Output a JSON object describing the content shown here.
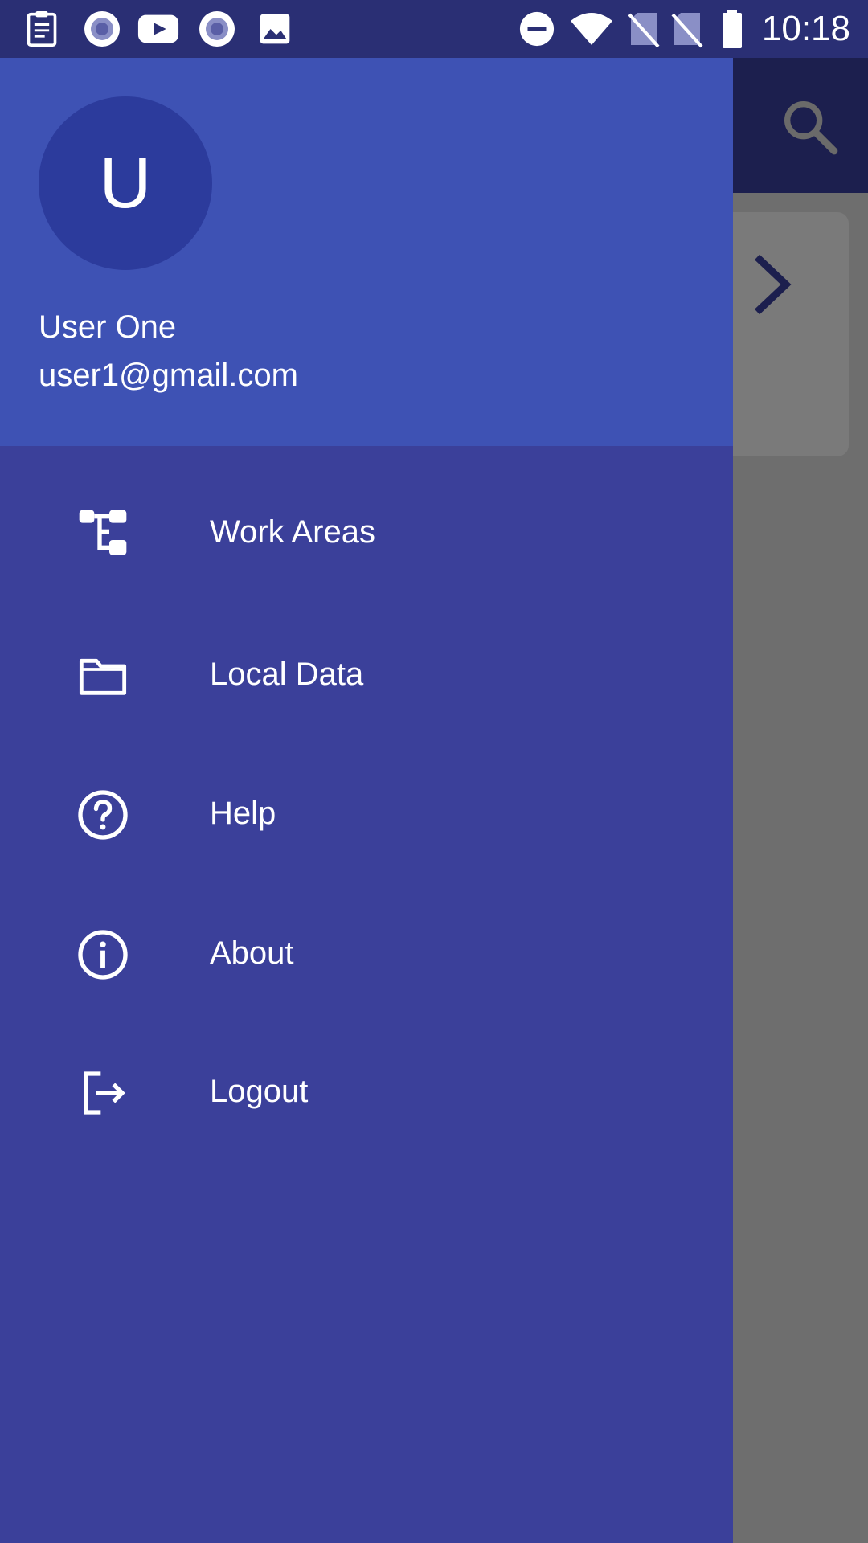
{
  "status_bar": {
    "time": "10:18",
    "left_icons": [
      "clipboard-icon",
      "circle-record-icon",
      "youtube-icon",
      "circle-record-icon",
      "image-icon"
    ],
    "right_icons": [
      "do-not-disturb-icon",
      "wifi-icon",
      "no-sim-icon",
      "no-sim-icon",
      "battery-icon"
    ]
  },
  "drawer": {
    "avatar_letter": "U",
    "user_name": "User One",
    "user_email": "user1@gmail.com",
    "items": [
      {
        "label": "Work Areas",
        "icon": "work-areas-icon"
      },
      {
        "label": "Local Data",
        "icon": "folder-icon"
      },
      {
        "label": "Help",
        "icon": "help-icon"
      },
      {
        "label": "About",
        "icon": "info-icon"
      },
      {
        "label": "Logout",
        "icon": "logout-icon"
      }
    ]
  },
  "colors": {
    "status_bar": "#2a2f74",
    "drawer_header": "#3e52b4",
    "drawer_body": "#3b409a",
    "avatar": "#2c3b9c",
    "scrim": "#6e6e6e"
  }
}
